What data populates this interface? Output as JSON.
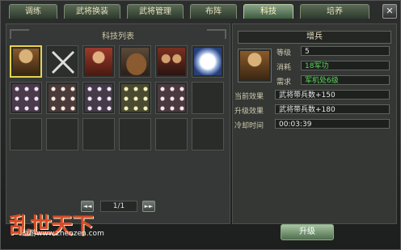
{
  "tabs": [
    {
      "label": "调练"
    },
    {
      "label": "武将换装"
    },
    {
      "label": "武将管理"
    },
    {
      "label": "布阵"
    },
    {
      "label": "科技"
    },
    {
      "label": "培养"
    }
  ],
  "close_icon": "close-icon",
  "left_panel": {
    "title": "科技列表",
    "pager": {
      "prev": "◄◄",
      "page": "1/1",
      "next": "►►"
    },
    "icons": [
      "general-soldier-icon",
      "crossed-swords-icon",
      "general-commander-icon",
      "cavalry-horse-icon",
      "troops-group-icon",
      "white-bird-icon",
      "dot-formation-icon",
      "dot-formation-icon",
      "dot-formation-icon",
      "dot-formation-icon",
      "dot-formation-icon",
      "empty-slot-icon",
      "empty-slot-icon",
      "empty-slot-icon",
      "empty-slot-icon",
      "empty-slot-icon",
      "empty-slot-icon",
      "empty-slot-icon"
    ]
  },
  "detail": {
    "title": "增兵",
    "level_label": "等级",
    "level_value": "5",
    "cost_label": "消耗",
    "cost_value": "18军功",
    "req_label": "需求",
    "req_value": "军机处6级",
    "current_label": "当前效果",
    "current_value": "武将带兵数+150",
    "upgrade_label": "升级效果",
    "upgrade_value": "武将带兵数+180",
    "cooldown_label": "冷却时间",
    "cooldown_value": "00:03:39"
  },
  "upgrade_button": "升级",
  "logo": {
    "text": "乱世天下",
    "url": "战游www.zhenzen.com"
  },
  "colors": {
    "accent_green": "#59d659",
    "tab_active": "#3d5b40",
    "logo_red": "#d84b2a"
  }
}
